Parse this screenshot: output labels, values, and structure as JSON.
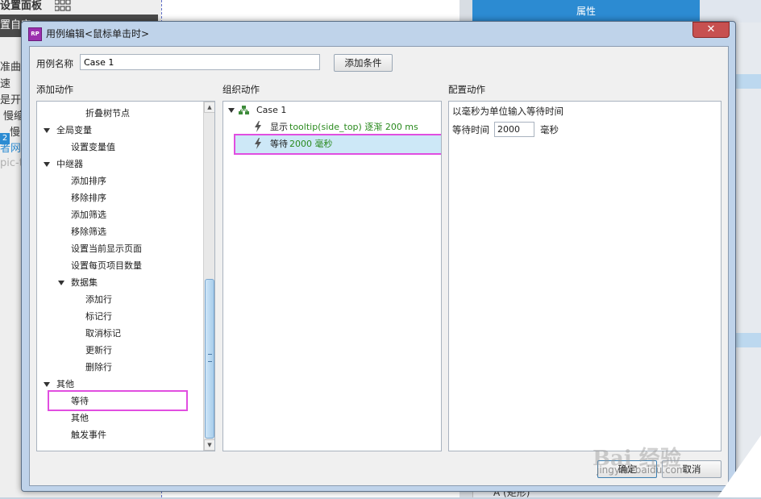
{
  "background": {
    "left_fragments": [
      "设置面板",
      "置自定",
      "准曲",
      "速",
      "是开好",
      "慢缩",
      "慢",
      "2",
      "者网站",
      "pic-t"
    ],
    "properties_tab": "属性",
    "canvas_fragment": "A (矩形)"
  },
  "dialog": {
    "title": "用例编辑<鼠标单击时>",
    "app_icon": "RP",
    "close_glyph": "✕",
    "case_name_label": "用例名称",
    "case_name_value": "Case 1",
    "add_condition_label": "添加条件",
    "ok_label": "确定",
    "cancel_label": "取消"
  },
  "add_actions": {
    "header": "添加动作",
    "items": [
      {
        "label": "折叠树节点",
        "level": 3,
        "expander": false
      },
      {
        "label": "全局变量",
        "level": 1,
        "expander": true
      },
      {
        "label": "设置变量值",
        "level": 2,
        "expander": false
      },
      {
        "label": "中继器",
        "level": 1,
        "expander": true
      },
      {
        "label": "添加排序",
        "level": 2,
        "expander": false
      },
      {
        "label": "移除排序",
        "level": 2,
        "expander": false
      },
      {
        "label": "添加筛选",
        "level": 2,
        "expander": false
      },
      {
        "label": "移除筛选",
        "level": 2,
        "expander": false
      },
      {
        "label": "设置当前显示页面",
        "level": 2,
        "expander": false
      },
      {
        "label": "设置每页项目数量",
        "level": 2,
        "expander": false
      },
      {
        "label": "数据集",
        "level": 2,
        "expander": true
      },
      {
        "label": "添加行",
        "level": 3,
        "expander": false
      },
      {
        "label": "标记行",
        "level": 3,
        "expander": false
      },
      {
        "label": "取消标记",
        "level": 3,
        "expander": false
      },
      {
        "label": "更新行",
        "level": 3,
        "expander": false
      },
      {
        "label": "删除行",
        "level": 3,
        "expander": false
      },
      {
        "label": "其他",
        "level": 1,
        "expander": true
      },
      {
        "label": "等待",
        "level": 2,
        "expander": false,
        "highlighted": true
      },
      {
        "label": "其他",
        "level": 2,
        "expander": false
      },
      {
        "label": "触发事件",
        "level": 2,
        "expander": false
      }
    ]
  },
  "organize_actions": {
    "header": "组织动作",
    "case_label": "Case 1",
    "actions": [
      {
        "verb": "显示",
        "detail": "tooltip(side_top) 逐渐 200 ms"
      },
      {
        "verb": "等待",
        "detail": "2000 毫秒",
        "selected": true
      }
    ]
  },
  "configure_action": {
    "header": "配置动作",
    "description": "以毫秒为单位输入等待时间",
    "wait_label": "等待时间",
    "wait_value": "2000",
    "unit": "毫秒"
  },
  "watermark": {
    "logo": "Bai 经验",
    "url": "jingyan.baidu.com"
  },
  "colors": {
    "highlight": "#e14ee0",
    "selection": "#cde8f7",
    "action_detail": "#2a8a1e",
    "title_accent": "#2c8bd2"
  }
}
